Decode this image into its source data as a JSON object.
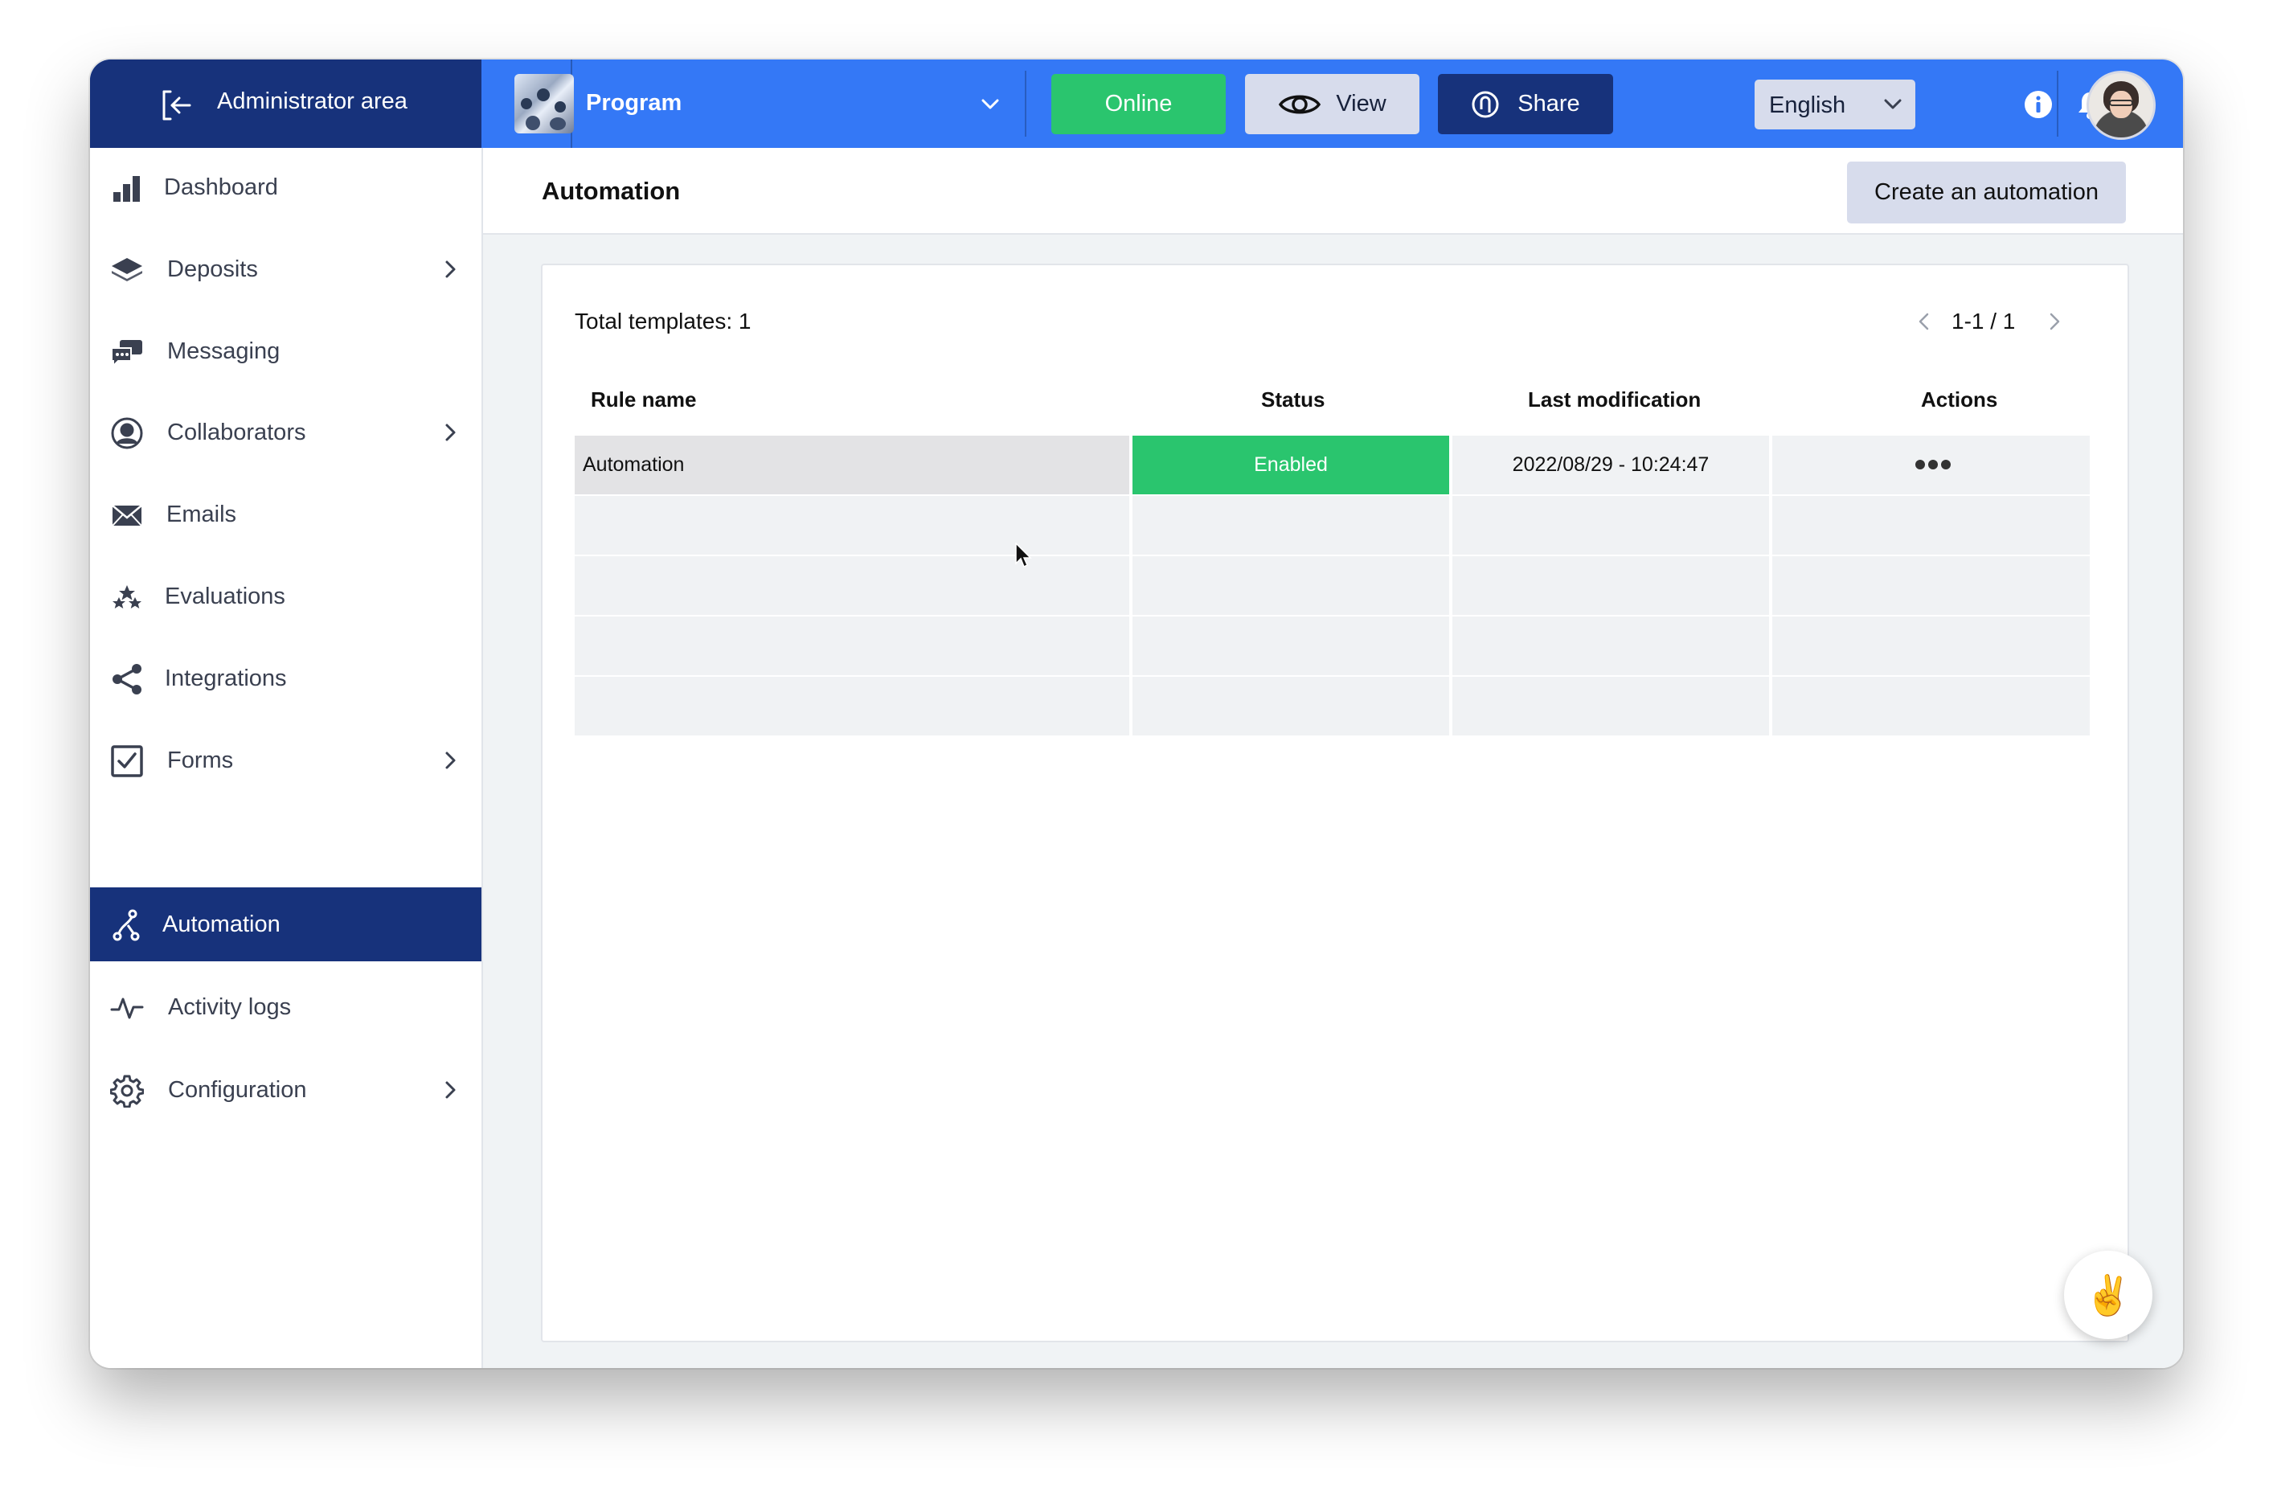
{
  "topbar": {
    "admin_label": "Administrator area",
    "program_label": "Program",
    "online_label": "Online",
    "view_label": "View",
    "share_label": "Share",
    "language": "English"
  },
  "sidebar": {
    "items": [
      {
        "label": "Dashboard",
        "icon": "bar-chart-icon"
      },
      {
        "label": "Deposits",
        "icon": "layers-icon"
      },
      {
        "label": "Messaging",
        "icon": "chat-icon"
      },
      {
        "label": "Collaborators",
        "icon": "user-circle-icon"
      },
      {
        "label": "Emails",
        "icon": "envelope-icon"
      },
      {
        "label": "Evaluations",
        "icon": "stars-icon"
      },
      {
        "label": "Integrations",
        "icon": "share-nodes-icon"
      },
      {
        "label": "Forms",
        "icon": "checkbox-icon"
      },
      {
        "label": "Automation",
        "icon": "automation-icon"
      },
      {
        "label": "Activity logs",
        "icon": "pulse-icon"
      },
      {
        "label": "Configuration",
        "icon": "gear-icon"
      }
    ],
    "active": "Automation"
  },
  "page": {
    "title": "Automation",
    "create_button": "Create an automation"
  },
  "table": {
    "total_label": "Total templates: 1",
    "pagination": "1-1 / 1",
    "headers": [
      "Rule name",
      "Status",
      "Last modification",
      "Actions"
    ],
    "rows": [
      {
        "rule_name": "Automation",
        "status": "Enabled",
        "last_modification": "2022/08/29 - 10:24:47"
      }
    ]
  },
  "colors": {
    "brand_blue": "#3478f6",
    "navy": "#17327b",
    "success_green": "#2ac56e"
  },
  "fab_emoji": "✌️"
}
